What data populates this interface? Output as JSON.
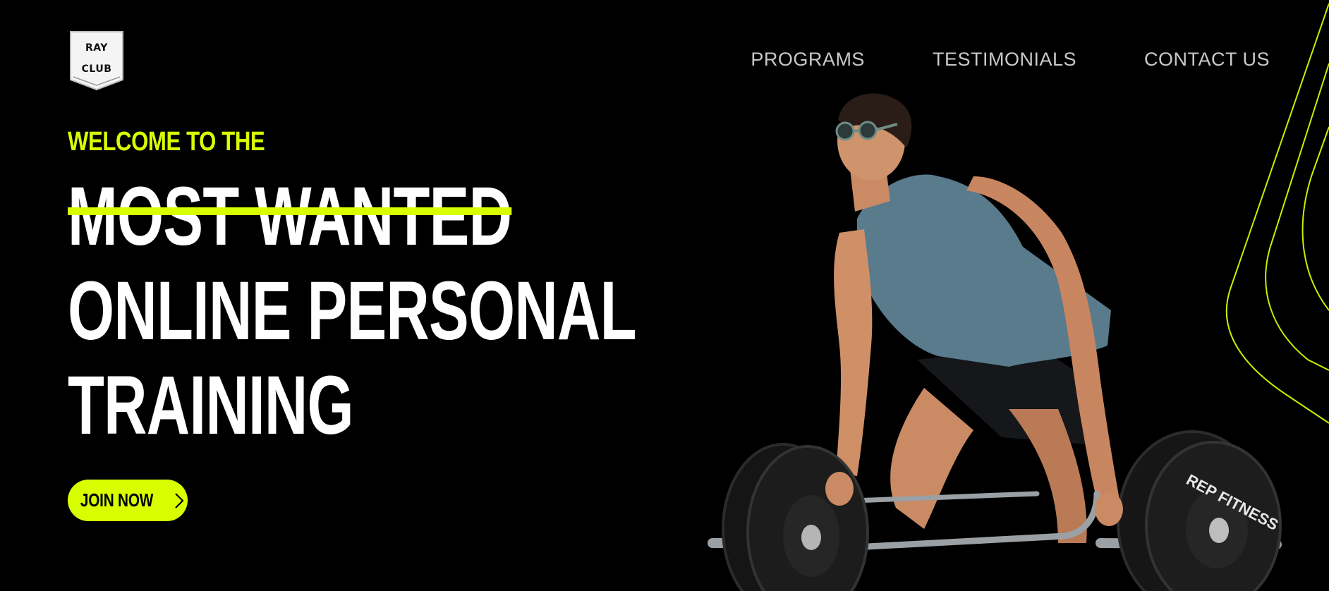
{
  "logo": {
    "line1": "RAY",
    "line2": "CLUB"
  },
  "nav": {
    "items": [
      {
        "label": "PROGRAMS"
      },
      {
        "label": "TESTIMONIALS"
      },
      {
        "label": "CONTACT US"
      }
    ]
  },
  "hero": {
    "eyebrow": "WELCOME TO THE",
    "headline_line1": "MOST WANTED",
    "headline_line2": "ONLINE PERSONAL",
    "headline_line3": "TRAINING",
    "cta_label": "JOIN NOW"
  },
  "image": {
    "plate_text": "REP FITNESS"
  },
  "colors": {
    "background": "#000000",
    "accent": "#d8ff00",
    "nav_text": "#c9c9c9",
    "headline": "#ffffff"
  },
  "icons": {
    "cta": "chevron-right-icon",
    "logo": "shield-badge-icon"
  }
}
